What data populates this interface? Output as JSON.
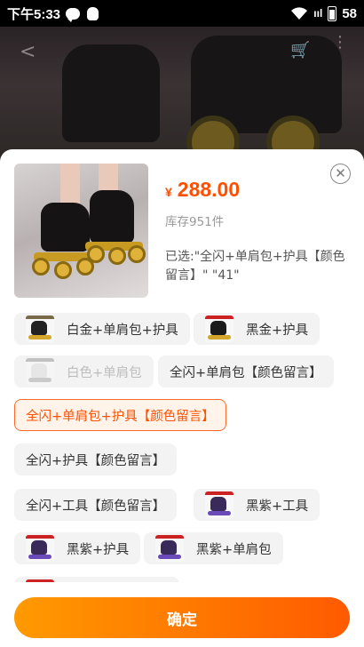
{
  "status_bar": {
    "time": "下午5:33",
    "signal": "ııl",
    "battery": "58"
  },
  "nav": {
    "back": "<",
    "cart": "🛒",
    "more": "⋮"
  },
  "product": {
    "currency": "¥",
    "price": "288.00",
    "stock": "库存951件",
    "selected": "已选:\"全闪+单肩包+护具【颜色留言】\" \"41\"",
    "close": "✕"
  },
  "options": [
    {
      "label": "白金+单肩包+护具",
      "state": "normal"
    },
    {
      "label": "黑金+护具",
      "state": "normal"
    },
    {
      "label": "白色+单肩包",
      "state": "disabled"
    },
    {
      "label": "全闪+单肩包【颜色留言】",
      "state": "normal"
    },
    {
      "label": "全闪+单肩包+护具【颜色留言】",
      "state": "selected"
    },
    {
      "label": "全闪+护具【颜色留言】",
      "state": "normal"
    },
    {
      "label": "全闪+工具【颜色留言】",
      "state": "normal"
    },
    {
      "label": "黑紫+工具",
      "state": "normal"
    },
    {
      "label": "黑紫+护具",
      "state": "normal"
    },
    {
      "label": "黑紫+单肩包",
      "state": "normal"
    }
  ],
  "confirm_label": "确定",
  "colors": {
    "accent": "#ff5000",
    "price": "#ff4f00",
    "button_start": "#ff9a00",
    "button_end": "#ff5a00"
  }
}
